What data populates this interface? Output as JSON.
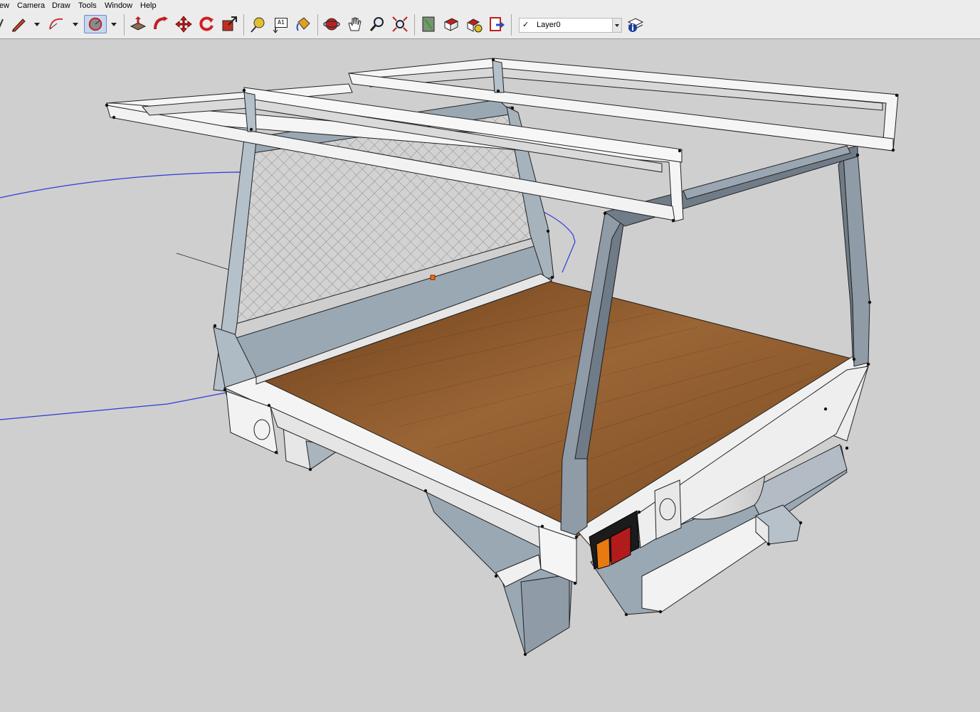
{
  "menu": [
    "ew",
    "Camera",
    "Draw",
    "Tools",
    "Window",
    "Help"
  ],
  "toolbar": {
    "tools": [
      {
        "name": "pencil-tool-icon"
      },
      {
        "name": "arc-tool-icon"
      },
      {
        "name": "circle-tool-icon",
        "active": true
      },
      {
        "name": "push-pull-tool-icon"
      },
      {
        "name": "follow-me-tool-icon"
      },
      {
        "name": "move-tool-icon"
      },
      {
        "name": "rotate-tool-icon"
      },
      {
        "name": "scale-tool-icon"
      },
      {
        "name": "tape-measure-tool-icon"
      },
      {
        "name": "text-tool-icon"
      },
      {
        "name": "paint-bucket-tool-icon"
      },
      {
        "name": "orbit-tool-icon"
      },
      {
        "name": "pan-tool-icon"
      },
      {
        "name": "zoom-tool-icon"
      },
      {
        "name": "zoom-extents-tool-icon"
      },
      {
        "name": "get-models-icon"
      },
      {
        "name": "share-model-icon"
      },
      {
        "name": "components-icon"
      },
      {
        "name": "export-icon"
      },
      {
        "name": "layer-manager-icon"
      }
    ],
    "text_tool_label": "A1",
    "layer": {
      "current": "Layer0",
      "check": "✓"
    }
  },
  "colors": {
    "background": "#cfcfcf",
    "toolbar": "#ececec",
    "frame_white": "#f5f5f5",
    "frame_grey": "#9aa8b3",
    "floor_wood": "#7a4a22",
    "axis_blue": "#2a3bd6",
    "taillight_orange": "#e87a10",
    "taillight_red": "#b21b1b"
  }
}
